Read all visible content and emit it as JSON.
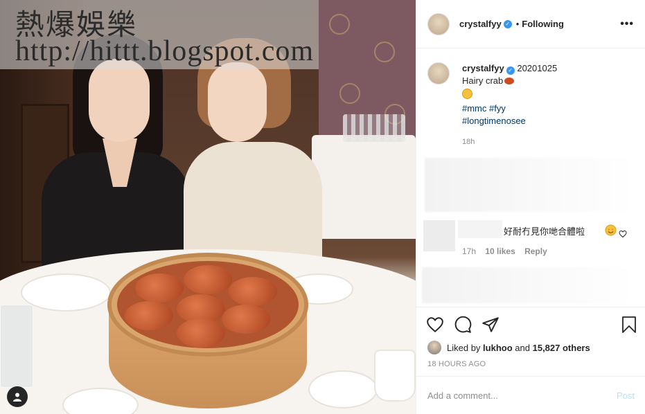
{
  "watermark": {
    "line1": "熱爆娛樂",
    "line2": "http://hittt.blogspot.com"
  },
  "header": {
    "username": "crystalfyy",
    "dot": "•",
    "follow_status": "Following",
    "more": "•••"
  },
  "caption": {
    "username": "crystalfyy",
    "date_tag": "20201025",
    "text": "Hairy crab",
    "hashtags_line1": [
      "#mmc",
      "#fyy"
    ],
    "hashtags_line2": [
      "#longtimenosee"
    ],
    "time": "18h"
  },
  "comment": {
    "text": "好耐冇見你哋合體啦",
    "time": "17h",
    "likes": "10 likes",
    "reply": "Reply"
  },
  "actions": {
    "liked_prefix": "Liked by",
    "liked_user": "lukhoo",
    "liked_and": "and",
    "liked_others": "15,827 others",
    "time_ago": "18 HOURS AGO"
  },
  "add_comment": {
    "placeholder": "Add a comment...",
    "post": "Post"
  },
  "colors": {
    "link": "#00376b",
    "verified": "#3897f0",
    "post_disabled": "#b2dffc",
    "meta": "#8e8e8e"
  }
}
